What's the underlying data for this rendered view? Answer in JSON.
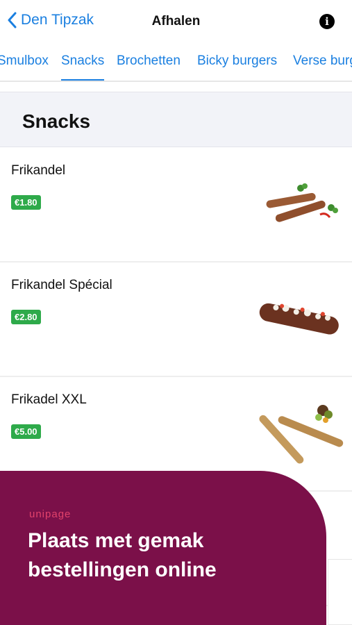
{
  "nav": {
    "back_label": "Den Tipzak",
    "title": "Afhalen",
    "info_icon": "i"
  },
  "tabs": [
    "Smulbox",
    "Snacks",
    "Brochetten",
    "Bicky burgers",
    "Verse burgers"
  ],
  "active_tab": "Snacks",
  "section": {
    "title": "Snacks"
  },
  "items": [
    {
      "name": "Frikandel",
      "price": "€1.80"
    },
    {
      "name": "Frikandel Spécial",
      "price": "€2.80"
    },
    {
      "name": "Frikadel XXL",
      "price": "€5.00"
    }
  ],
  "promo": {
    "brand": "unipage",
    "line1": "Plaats met gemak",
    "line2": "bestellingen online"
  },
  "colors": {
    "accent": "#1a7fe0",
    "price_badge": "#2eaa4a",
    "promo_bg": "#7b1049",
    "promo_brand": "#e2426b"
  }
}
